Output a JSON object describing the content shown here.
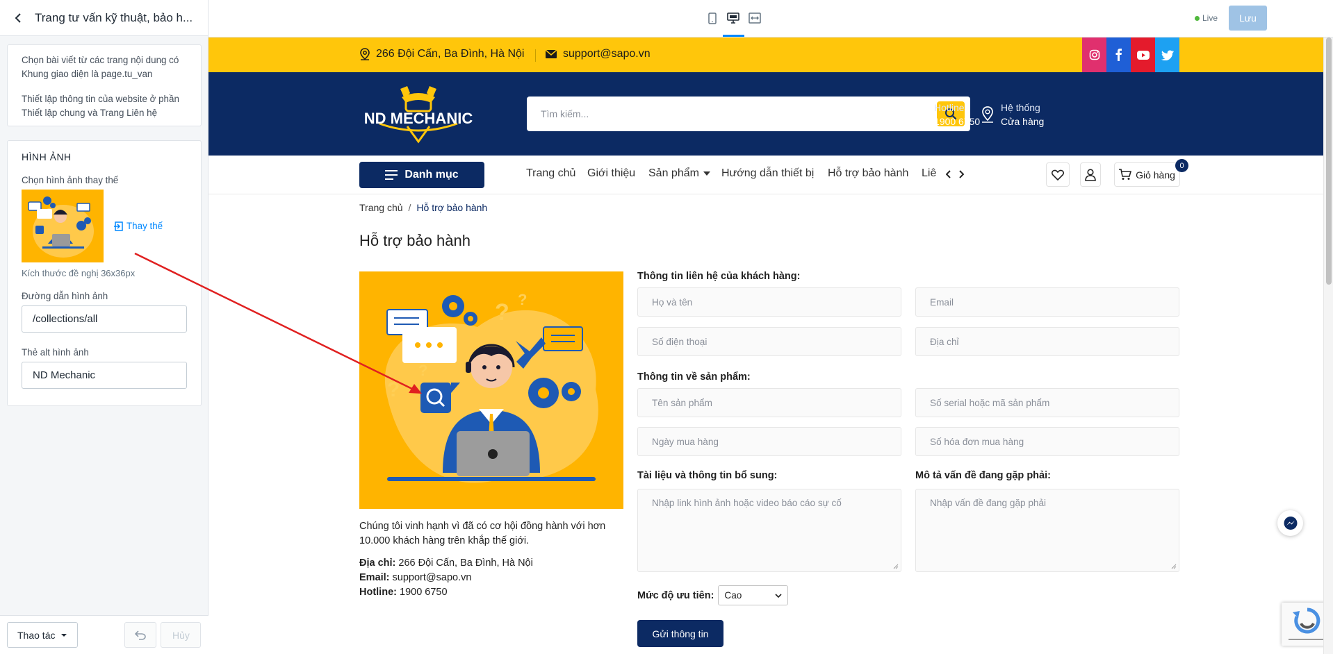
{
  "editor": {
    "title": "Trang tư vấn kỹ thuật, bảo h...",
    "info_line1": "Chọn bài viết từ các trang nội dung có Khung giao diện là page.tu_van",
    "info_line2": "Thiết lập thông tin của website ở phần Thiết lập chung và Trang Liên hệ",
    "image_section": {
      "title": "HÌNH ẢNH",
      "choose_label": "Chọn hình ảnh thay thế",
      "replace_label": "Thay thế",
      "size_hint": "Kích thước đề nghị 36x36px",
      "link_label": "Đường dẫn hình ảnh",
      "link_value": "/collections/all",
      "alt_label": "Thẻ alt hình ảnh",
      "alt_value": "ND Mechanic"
    },
    "footer": {
      "actions_label": "Thao tác",
      "cancel_label": "Hủy"
    }
  },
  "topbar": {
    "live_label": "Live",
    "save_label": "Lưu"
  },
  "site": {
    "address": "266 Đội Cấn, Ba Đình, Hà Nội",
    "email": "support@sapo.vn",
    "logo_text": "ND MECHANIC",
    "search_placeholder": "Tìm kiếm...",
    "hotline_label": "Hotline",
    "hotline_value": "1900 6750",
    "stores_label": "Hệ thống",
    "stores_value": "Cửa hàng",
    "category_button": "Danh mục",
    "nav": [
      "Trang chủ",
      "Giới thiệu",
      "Sản phẩm",
      "Hướng dẫn thiết bị",
      "Hỗ trợ bảo hành",
      "Liê"
    ],
    "cart_label": "Giỏ hàng",
    "cart_count": "0",
    "breadcrumb_home": "Trang chủ",
    "breadcrumb_sep": "/",
    "breadcrumb_current": "Hỗ trợ bảo hành",
    "page_title": "Hỗ trợ bảo hành",
    "intro": "Chúng tôi vinh hạnh vì đã có cơ hội đồng hành với hơn 10.000 khách hàng trên khắp thế giới.",
    "contact": {
      "address_label": "Địa chỉ:",
      "address_value": "266 Đội Cấn, Ba Đình, Hà Nội",
      "email_label": "Email:",
      "email_value": "support@sapo.vn",
      "hotline_label": "Hotline:",
      "hotline_value": "1900 6750"
    },
    "form": {
      "customer_title": "Thông tin liên hệ của khách hàng:",
      "name_ph": "Họ và tên",
      "email_ph": "Email",
      "phone_ph": "Số điện thoại",
      "address_ph": "Địa chỉ",
      "product_title": "Thông tin về sản phẩm:",
      "product_ph": "Tên sản phẩm",
      "serial_ph": "Số serial hoặc mã sản phẩm",
      "date_ph": "Ngày mua hàng",
      "invoice_ph": "Số hóa đơn mua hàng",
      "docs_title": "Tài liệu và thông tin bổ sung:",
      "docs_ph": "Nhập link hình ảnh hoặc video báo cáo sự cố",
      "issue_title": "Mô tả vấn đề đang gặp phải:",
      "issue_ph": "Nhập vấn đề đang gặp phải",
      "priority_label": "Mức độ ưu tiên:",
      "priority_value": "Cao",
      "submit_label": "Gửi thông tin"
    }
  },
  "colors": {
    "brand_navy": "#0c2a63",
    "brand_yellow": "#ffc60b",
    "accent_blue": "#0088ff",
    "annotation_red": "#e02020"
  },
  "icons": [
    "chevron-left-icon",
    "mobile-icon",
    "desktop-icon",
    "fullwidth-icon",
    "map-pin-icon",
    "mail-icon",
    "instagram-icon",
    "facebook-icon",
    "youtube-icon",
    "twitter-icon",
    "search-icon",
    "phone-icon",
    "location-icon",
    "menu-icon",
    "caret-down-icon",
    "heart-icon",
    "user-icon",
    "cart-icon",
    "messenger-icon",
    "undo-icon"
  ]
}
